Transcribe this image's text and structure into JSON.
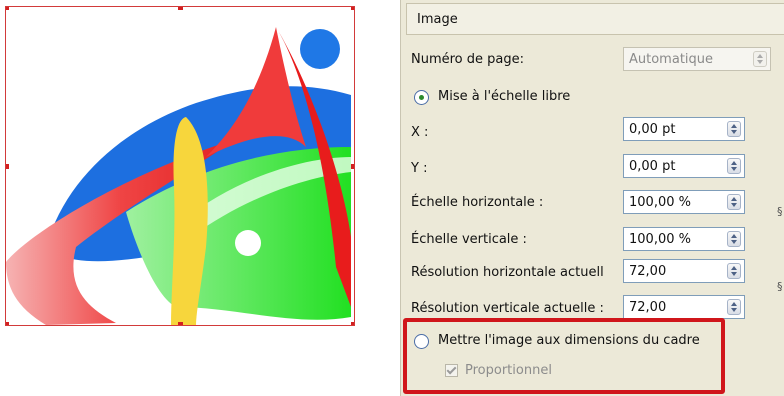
{
  "panel": {
    "section_title": "Image",
    "page_number": {
      "label": "Numéro de page:",
      "value": "Automatique"
    },
    "free_scaling": {
      "label": "Mise à l'échelle libre",
      "selected": true
    },
    "x": {
      "label": "X :",
      "value": "0,00 pt"
    },
    "y": {
      "label": "Y :",
      "value": "0,00 pt"
    },
    "scale_h": {
      "label": "Échelle horizontale :",
      "value": "100,00 %"
    },
    "scale_v": {
      "label": "Échelle verticale :",
      "value": "100,00 %"
    },
    "res_h": {
      "label": "Résolution horizontale actuell",
      "value": "72,00"
    },
    "res_v": {
      "label": "Résolution verticale actuelle :",
      "value": "72,00"
    },
    "fit_frame": {
      "label": "Mettre l'image aux dimensions du cadre",
      "selected": false
    },
    "proportional": {
      "label": "Proportionnel",
      "checked": true,
      "enabled": false
    }
  },
  "colors": {
    "highlight": "#d0161b",
    "panel_bg": "#ece9d8",
    "frame_border": "#d23a3a"
  }
}
